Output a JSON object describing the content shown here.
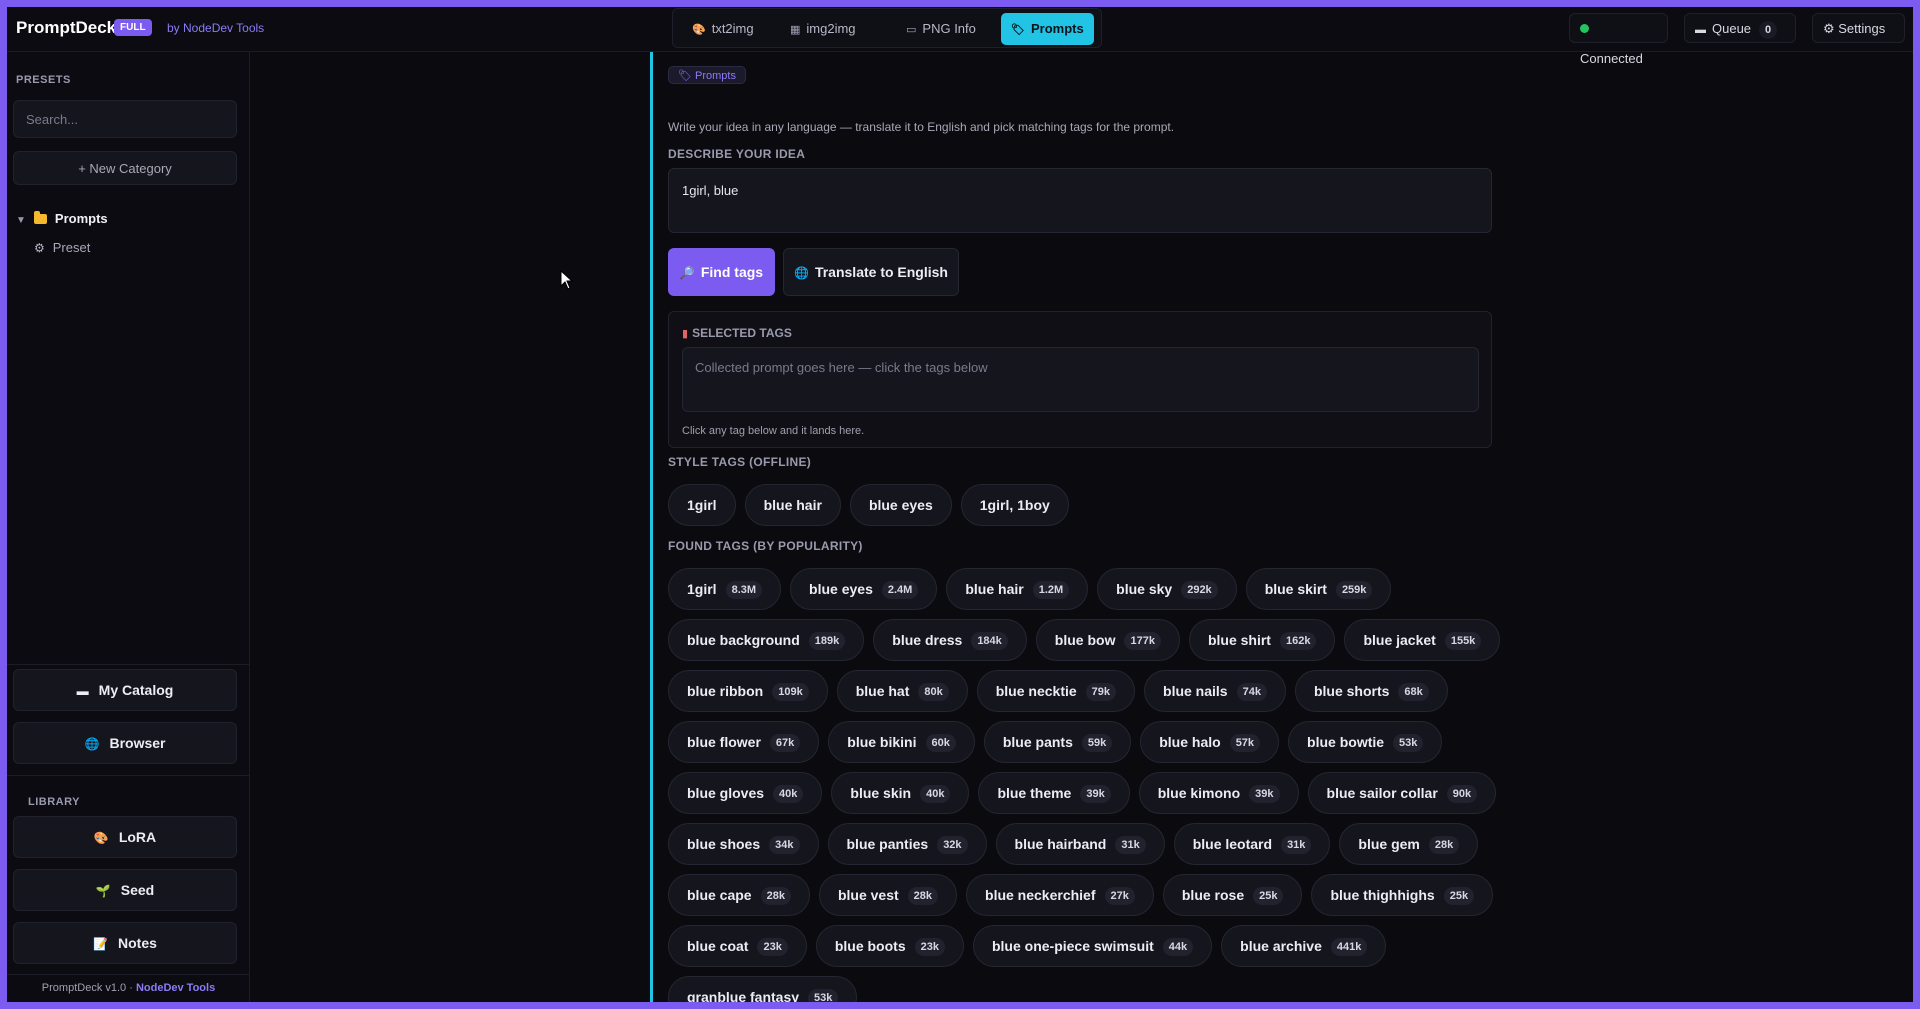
{
  "header": {
    "app_name": "PromptDeck",
    "edition_badge": "FULL",
    "byline": "by NodeDev Tools",
    "tabs": [
      {
        "icon": "🎨",
        "label": "txt2img"
      },
      {
        "icon": "▦",
        "label": "img2img"
      },
      {
        "icon": "▭",
        "label": "PNG Info"
      },
      {
        "icon": "🏷",
        "label": "Prompts"
      }
    ],
    "status": "Connected",
    "queue_label": "Queue",
    "queue_count": "0",
    "settings_label": "⚙ Settings"
  },
  "sidebar": {
    "presets_heading": "PRESETS",
    "search_placeholder": "Search...",
    "new_category": "+ New Category",
    "tree": {
      "folder": "Prompts",
      "item": "Preset"
    },
    "my_catalog": "My Catalog",
    "browser": "Browser",
    "library_heading": "LIBRARY",
    "lora": "LoRA",
    "seed": "Seed",
    "notes": "Notes",
    "footer_version": "PromptDeck v1.0 · ",
    "footer_brand": "NodeDev Tools"
  },
  "main": {
    "chip": "🏷 Prompts",
    "hint": "Write your idea in any language — translate it to English and pick matching tags for the prompt.",
    "describe_heading": "DESCRIBE YOUR IDEA",
    "idea_text": "1girl, blue",
    "find_tags": "Find tags",
    "translate": "Translate to English",
    "selected_heading": "SELECTED TAGS",
    "selected_placeholder": "Collected prompt goes here — click the tags below",
    "selected_note": "Click any tag below and it lands here.",
    "style_heading": "STYLE TAGS (OFFLINE)",
    "style_tags": [
      "1girl",
      "blue hair",
      "blue eyes",
      "1girl, 1boy"
    ],
    "found_heading": "FOUND TAGS (BY POPULARITY)",
    "found_tags": [
      {
        "name": "1girl",
        "count": "8.3M"
      },
      {
        "name": "blue eyes",
        "count": "2.4M"
      },
      {
        "name": "blue hair",
        "count": "1.2M"
      },
      {
        "name": "blue sky",
        "count": "292k"
      },
      {
        "name": "blue skirt",
        "count": "259k"
      },
      {
        "name": "blue background",
        "count": "189k"
      },
      {
        "name": "blue dress",
        "count": "184k"
      },
      {
        "name": "blue bow",
        "count": "177k"
      },
      {
        "name": "blue shirt",
        "count": "162k"
      },
      {
        "name": "blue jacket",
        "count": "155k"
      },
      {
        "name": "blue ribbon",
        "count": "109k"
      },
      {
        "name": "blue hat",
        "count": "80k"
      },
      {
        "name": "blue necktie",
        "count": "79k"
      },
      {
        "name": "blue nails",
        "count": "74k"
      },
      {
        "name": "blue shorts",
        "count": "68k"
      },
      {
        "name": "blue flower",
        "count": "67k"
      },
      {
        "name": "blue bikini",
        "count": "60k"
      },
      {
        "name": "blue pants",
        "count": "59k"
      },
      {
        "name": "blue halo",
        "count": "57k"
      },
      {
        "name": "blue bowtie",
        "count": "53k"
      },
      {
        "name": "blue gloves",
        "count": "40k"
      },
      {
        "name": "blue skin",
        "count": "40k"
      },
      {
        "name": "blue theme",
        "count": "39k"
      },
      {
        "name": "blue kimono",
        "count": "39k"
      },
      {
        "name": "blue sailor collar",
        "count": "90k"
      },
      {
        "name": "blue shoes",
        "count": "34k"
      },
      {
        "name": "blue panties",
        "count": "32k"
      },
      {
        "name": "blue hairband",
        "count": "31k"
      },
      {
        "name": "blue leotard",
        "count": "31k"
      },
      {
        "name": "blue gem",
        "count": "28k"
      },
      {
        "name": "blue cape",
        "count": "28k"
      },
      {
        "name": "blue vest",
        "count": "28k"
      },
      {
        "name": "blue neckerchief",
        "count": "27k"
      },
      {
        "name": "blue rose",
        "count": "25k"
      },
      {
        "name": "blue thighhighs",
        "count": "25k"
      },
      {
        "name": "blue coat",
        "count": "23k"
      },
      {
        "name": "blue boots",
        "count": "23k"
      },
      {
        "name": "blue one-piece swimsuit",
        "count": "44k"
      },
      {
        "name": "blue archive",
        "count": "441k"
      },
      {
        "name": "granblue fantasy",
        "count": "53k"
      }
    ]
  },
  "colors": {
    "accent": "#7c5cf0",
    "active_tab": "#22c4e6",
    "status_ok": "#22c55e"
  }
}
